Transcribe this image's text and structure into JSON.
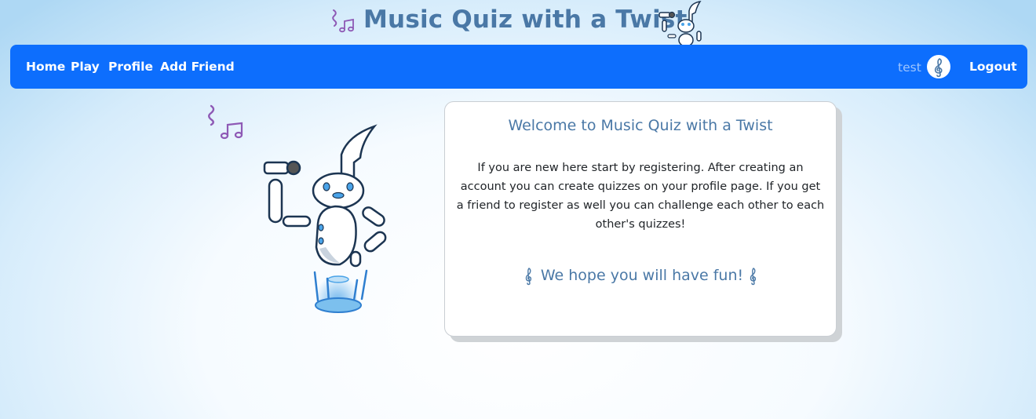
{
  "header": {
    "title": "Music Quiz with a Twist",
    "icons": [
      "music-notes-icon",
      "robot-mascot-icon"
    ]
  },
  "nav": {
    "links": [
      "Home",
      "Play",
      "Profile",
      "Add Friend"
    ],
    "username": "test",
    "avatar_icon": "treble-clef-icon",
    "logout": "Logout"
  },
  "card": {
    "title": "Welcome to Music Quiz with a Twist",
    "body": "If you are new here start by registering. After creating an account you can create quizzes on your profile page. If you get a friend to register as well you can challenge each other to each other's quizzes!",
    "fun": "We hope you will have fun!",
    "icons": [
      "treble-clef-icon"
    ]
  },
  "mascot": {
    "icon": "robot-singing-icon"
  },
  "colors": {
    "navbar": "#0d6efd",
    "title": "#4a78a6",
    "note_purple": "#8e59b5",
    "robot_outline": "#1c3552",
    "glow_blue": "#4aa3e8"
  }
}
